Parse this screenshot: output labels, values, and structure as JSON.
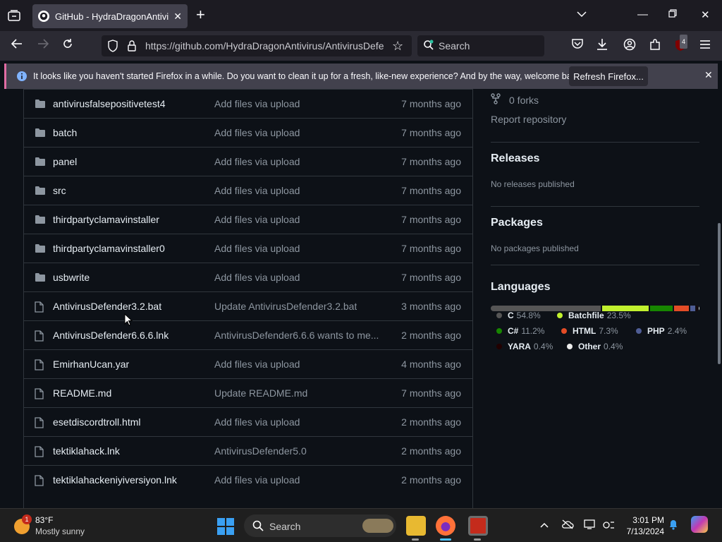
{
  "browser": {
    "tab_title": "GitHub - HydraDragonAntiviru",
    "url": "https://github.com/HydraDragonAntivirus/AntivirusDefe",
    "search_placeholder": "Search",
    "extension_badge": "4"
  },
  "notification": {
    "text": "It looks like you haven't started Firefox in a while. Do you want to clean it up for a fresh, like-new experience? And by the way, welcome back!",
    "button": "Refresh Firefox..."
  },
  "files": [
    {
      "type": "folder",
      "name": "antivirusfalsepositivetest4",
      "message": "Add files via upload",
      "time": "7 months ago"
    },
    {
      "type": "folder",
      "name": "batch",
      "message": "Add files via upload",
      "time": "7 months ago"
    },
    {
      "type": "folder",
      "name": "panel",
      "message": "Add files via upload",
      "time": "7 months ago"
    },
    {
      "type": "folder",
      "name": "src",
      "message": "Add files via upload",
      "time": "7 months ago"
    },
    {
      "type": "folder",
      "name": "thirdpartyclamavinstaller",
      "message": "Add files via upload",
      "time": "7 months ago"
    },
    {
      "type": "folder",
      "name": "thirdpartyclamavinstaller0",
      "message": "Add files via upload",
      "time": "7 months ago"
    },
    {
      "type": "folder",
      "name": "usbwrite",
      "message": "Add files via upload",
      "time": "7 months ago"
    },
    {
      "type": "file",
      "name": "AntivirusDefender3.2.bat",
      "message": "Update AntivirusDefender3.2.bat",
      "time": "3 months ago"
    },
    {
      "type": "file",
      "name": "AntivirusDefender6.6.6.lnk",
      "message": "AntivirusDefender6.6.6 wants to me...",
      "time": "2 months ago"
    },
    {
      "type": "file",
      "name": "EmirhanUcan.yar",
      "message": "Add files via upload",
      "time": "4 months ago"
    },
    {
      "type": "file",
      "name": "README.md",
      "message": "Update README.md",
      "time": "7 months ago"
    },
    {
      "type": "file",
      "name": "esetdiscordtroll.html",
      "message": "Add files via upload",
      "time": "2 months ago"
    },
    {
      "type": "file",
      "name": "tektiklahack.lnk",
      "message": "AntivirusDefender5.0",
      "time": "2 months ago"
    },
    {
      "type": "file",
      "name": "tektiklahackeniyiversiyon.lnk",
      "message": "Add files via upload",
      "time": "2 months ago"
    }
  ],
  "sidebar": {
    "forks": "0 forks",
    "report": "Report repository",
    "releases_title": "Releases",
    "releases_sub": "No releases published",
    "packages_title": "Packages",
    "packages_sub": "No packages published",
    "languages_title": "Languages",
    "languages": [
      {
        "name": "C",
        "pct": "54.8%",
        "value": 54.8,
        "color": "#555555"
      },
      {
        "name": "Batchfile",
        "pct": "23.5%",
        "value": 23.5,
        "color": "#c1f12e"
      },
      {
        "name": "C#",
        "pct": "11.2%",
        "value": 11.2,
        "color": "#178600"
      },
      {
        "name": "HTML",
        "pct": "7.3%",
        "value": 7.3,
        "color": "#e34c26"
      },
      {
        "name": "PHP",
        "pct": "2.4%",
        "value": 2.4,
        "color": "#4F5D95"
      },
      {
        "name": "YARA",
        "pct": "0.4%",
        "value": 0.4,
        "color": "#220000"
      },
      {
        "name": "Other",
        "pct": "0.4%",
        "value": 0.4,
        "color": "#ededed"
      }
    ]
  },
  "taskbar": {
    "weather_badge": "1",
    "temperature": "83°F",
    "weather": "Mostly sunny",
    "search": "Search",
    "time": "3:01 PM",
    "date": "7/13/2024"
  }
}
